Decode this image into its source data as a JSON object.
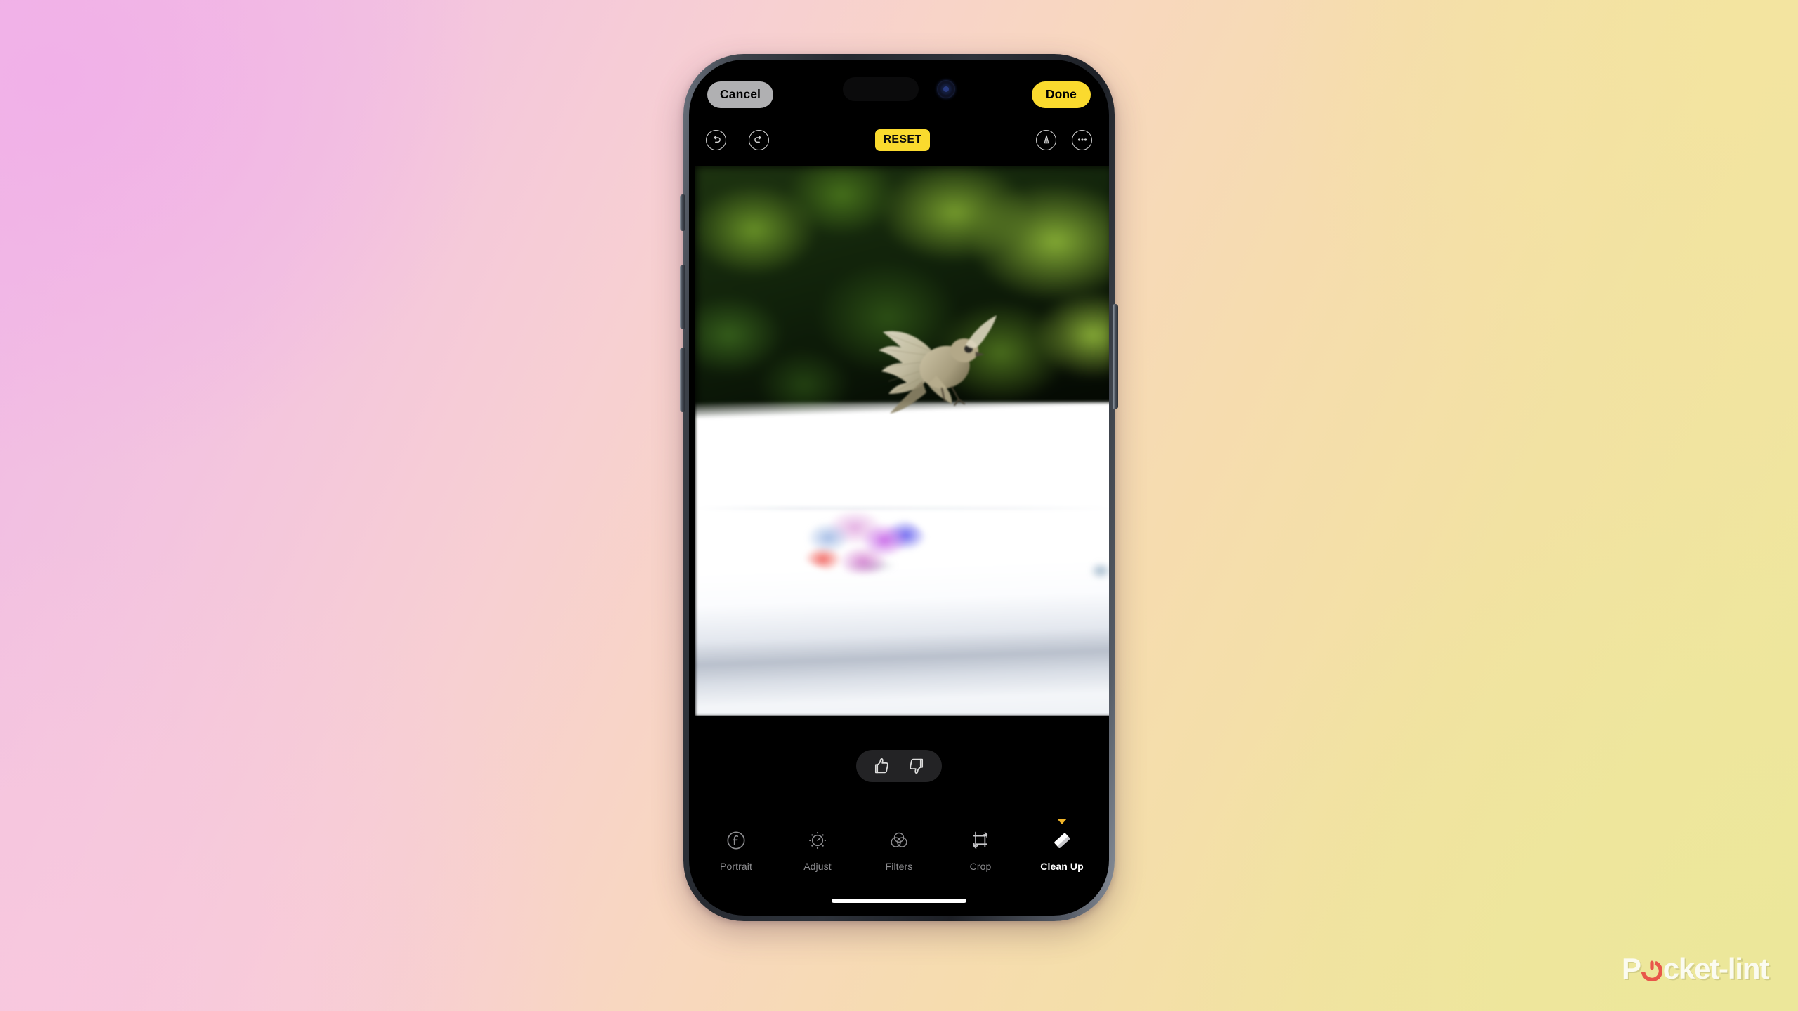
{
  "app": {
    "name": "Photos Editor",
    "platform": "iOS",
    "screen_mode": "Clean Up editing"
  },
  "background": {
    "gradient_from": "#f0b8e6",
    "gradient_mid": "#f8d7c0",
    "gradient_to": "#eee89c"
  },
  "device": {
    "model_hint": "iPhone Pro",
    "frame_color": "#3c4149",
    "buttons": {
      "action": "action-button",
      "volume_up": "volume-up-button",
      "volume_down": "volume-down-button",
      "power": "side-power-button"
    }
  },
  "topbar": {
    "cancel_label": "Cancel",
    "done_label": "Done",
    "cancel_bg": "#b0b0b2",
    "done_bg": "#fada2e"
  },
  "edit_toolbar": {
    "undo_icon": "undo-arrow-icon",
    "redo_icon": "redo-arrow-icon",
    "reset_label": "RESET",
    "reset_bg": "#fada2e",
    "markup_icon": "markup-pen-icon",
    "more_icon": "more-ellipsis-icon"
  },
  "photo": {
    "subject": "bird in flight over white surface",
    "foliage_color": "#2b5214",
    "surface_color": "#ffffff",
    "cleanup_selection": {
      "visible": true,
      "shape": "rainbow blob",
      "colors": [
        "#f05852",
        "#c460e6",
        "#605cee",
        "#96b2e2"
      ]
    }
  },
  "feedback": {
    "thumbs_up_icon": "thumbs-up-icon",
    "thumbs_down_icon": "thumbs-down-icon",
    "background": "#232325"
  },
  "tools": [
    {
      "label": "Portrait",
      "icon": "portrait-f-icon",
      "active": false
    },
    {
      "label": "Adjust",
      "icon": "adjust-dial-icon",
      "active": false
    },
    {
      "label": "Filters",
      "icon": "filters-circles-icon",
      "active": false
    },
    {
      "label": "Crop",
      "icon": "crop-rotate-icon",
      "active": false
    },
    {
      "label": "Clean Up",
      "icon": "cleanup-eraser-icon",
      "active": true
    }
  ],
  "selection_indicator_color": "#f0b429",
  "watermark": {
    "text_before": "P",
    "text_after": "cket-lint",
    "full_text": "Pocket-lint",
    "accent_color": "#e8574a",
    "text_color": "#fbfbf0"
  }
}
